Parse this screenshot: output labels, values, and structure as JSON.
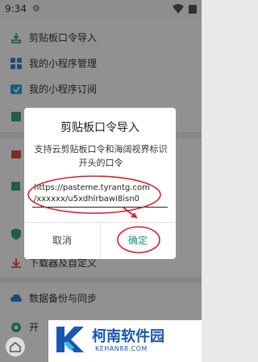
{
  "status_bar": {
    "time": "9:34"
  },
  "menu": {
    "items": [
      {
        "label": "剪贴板口令导入",
        "icon": "clipboard-import-icon",
        "color": "#3aa86b"
      },
      {
        "label": "我的小程序管理",
        "icon": "grid-apps-icon",
        "color": "#3e7fd6"
      },
      {
        "label": "我的小程序订阅",
        "icon": "subscribe-icon",
        "color": "#2aa3c4"
      },
      {
        "label": "",
        "icon": "book-icon",
        "color": "#3aa86b"
      },
      {
        "label": "",
        "icon": "gift-icon",
        "color": "#e04a3a"
      },
      {
        "label": "",
        "icon": "puzzle-icon",
        "color": "#3aa86b"
      },
      {
        "label": "",
        "icon": "shield-icon",
        "color": "#3aa86b"
      },
      {
        "label": "下载器及自定义",
        "icon": "download-icon",
        "color": "#e04a3a"
      },
      {
        "label": "数据备份与同步",
        "icon": "cloud-sync-icon",
        "color": "#2f7fd6"
      },
      {
        "label": "开",
        "icon": "settings-icon",
        "color": "#3aa86b"
      }
    ]
  },
  "dialog": {
    "title": "剪贴板口令导入",
    "message_line1": "支持云剪贴板口令和海阔视界标识",
    "message_line2": "开头的口令",
    "input_line1": "https://pasteme.tyrantg.com",
    "input_line2": "/xxxxxx/u5xdhlrbawi8isn0",
    "cancel_label": "取消",
    "ok_label": "确定",
    "accent": "#1f8f7f",
    "annotation_color": "#d8202a"
  },
  "watermark": {
    "title": "柯南软件园",
    "url": "KEHAN88.COM",
    "color": "#1a56b0"
  }
}
